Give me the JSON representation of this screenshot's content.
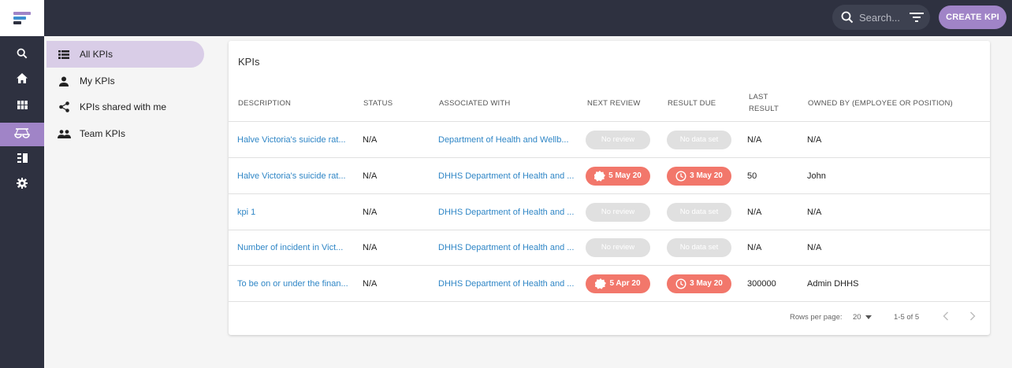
{
  "header": {
    "search_placeholder": "Search...",
    "create_button": "CREATE KPI"
  },
  "colors": {
    "topbar": "#2e3140",
    "accent": "#a084c7",
    "active_nav": "#d9cde7",
    "link": "#2f86c6",
    "overdue": "#f2776b"
  },
  "rail": {
    "icons": [
      "search-icon",
      "home-icon",
      "grid-icon",
      "scales-icon",
      "list-icon",
      "gear-icon"
    ]
  },
  "sidenav": {
    "items": [
      {
        "label": "All KPIs",
        "icon": "list-icon"
      },
      {
        "label": "My KPIs",
        "icon": "person-icon"
      },
      {
        "label": "KPIs shared with me",
        "icon": "share-icon"
      },
      {
        "label": "Team KPIs",
        "icon": "group-icon"
      }
    ]
  },
  "card": {
    "title": "KPIs",
    "columns": {
      "description": "DESCRIPTION",
      "status": "STATUS",
      "associated": "ASSOCIATED WITH",
      "next_review": "NEXT REVIEW",
      "result_due": "RESULT DUE",
      "last_result_1": "LAST",
      "last_result_2": "RESULT",
      "owned_by": "OWNED BY (EMPLOYEE OR POSITION)"
    },
    "rows": [
      {
        "description": "Halve Victoria's suicide rat...",
        "status": "N/A",
        "associated": "Department of Health and Wellb...",
        "next_review": "No review",
        "result_due": "No data set",
        "last_result": "N/A",
        "owner": "N/A"
      },
      {
        "description": "Halve Victoria's suicide rat...",
        "status": "N/A",
        "associated": "DHHS Department of Health and ...",
        "next_review": "5 May 20",
        "result_due": "3 May 20",
        "last_result": "50",
        "owner": "John"
      },
      {
        "description": "kpi 1",
        "status": "N/A",
        "associated": "DHHS Department of Health and ...",
        "next_review": "No review",
        "result_due": "No data set",
        "last_result": "N/A",
        "owner": "N/A"
      },
      {
        "description": "Number of incident in Vict...",
        "status": "N/A",
        "associated": "DHHS Department of Health and ...",
        "next_review": "No review",
        "result_due": "No data set",
        "last_result": "N/A",
        "owner": "N/A"
      },
      {
        "description": "To be on or under the finan...",
        "status": "N/A",
        "associated": "DHHS Department of Health and ...",
        "next_review": "5 Apr 20",
        "result_due": "3 May 20",
        "last_result": "300000",
        "owner": "Admin DHHS"
      }
    ],
    "footer": {
      "rows_per_page_label": "Rows per page:",
      "rows_per_page_value": "20",
      "range": "1-5 of 5"
    }
  }
}
